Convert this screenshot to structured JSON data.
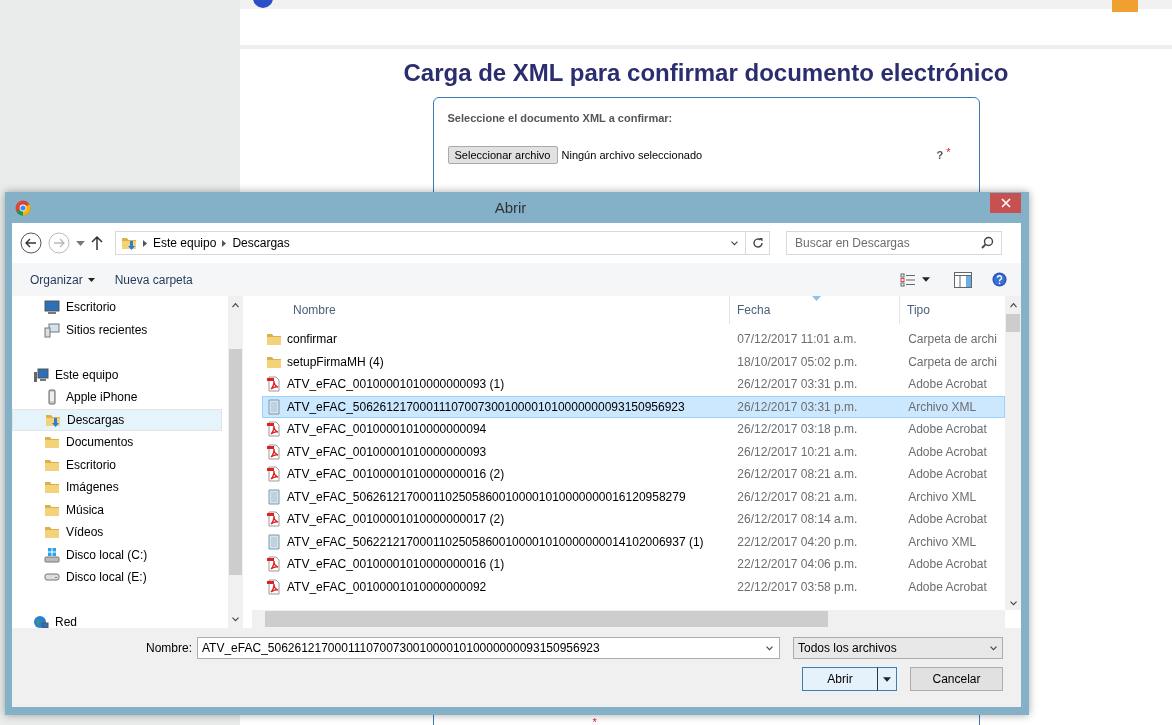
{
  "page": {
    "title": "Carga de XML para confirmar documento electrónico",
    "form": {
      "label": "Seleccione el documento XML a confirmar:",
      "file_button": "Seleccionar archivo",
      "file_status": "Ningún archivo seleccionado",
      "help": "?",
      "required": "*",
      "required_bottom": "*"
    }
  },
  "dialog": {
    "title": "Abrir",
    "breadcrumbs": [
      "Este equipo",
      "Descargas"
    ],
    "search": {
      "placeholder": "Buscar en Descargas"
    },
    "toolbar": {
      "organize": "Organizar",
      "new_folder": "Nueva carpeta"
    },
    "nav": [
      {
        "children": [
          {
            "label": "Escritorio",
            "kind": "desktop",
            "selected": false
          },
          {
            "label": "Sitios recientes",
            "kind": "recent",
            "selected": false
          }
        ]
      },
      {
        "label": "Este equipo",
        "kind": "computer",
        "selected": false,
        "children": [
          {
            "label": "Apple iPhone",
            "kind": "phone",
            "selected": false
          },
          {
            "label": "Descargas",
            "kind": "downloads",
            "selected": true
          },
          {
            "label": "Documentos",
            "kind": "folder",
            "selected": false
          },
          {
            "label": "Escritorio",
            "kind": "folder",
            "selected": false
          },
          {
            "label": "Imágenes",
            "kind": "folder",
            "selected": false
          },
          {
            "label": "Música",
            "kind": "folder",
            "selected": false
          },
          {
            "label": "Vídeos",
            "kind": "folder",
            "selected": false
          },
          {
            "label": "Disco local (C:)",
            "kind": "system-drive",
            "selected": false
          },
          {
            "label": "Disco local (E:)",
            "kind": "drive",
            "selected": false
          }
        ]
      },
      {
        "label": "Red",
        "kind": "network",
        "selected": false
      }
    ],
    "columns": [
      "Nombre",
      "Fecha",
      "Tipo"
    ],
    "files": [
      {
        "kind": "folder",
        "name": "confirmar",
        "date": "07/12/2017 11:01 a.m.",
        "type": "Carpeta de archi",
        "selected": false
      },
      {
        "kind": "folder",
        "name": "setupFirmaMH (4)",
        "date": "18/10/2017 05:02 p.m.",
        "type": "Carpeta de archi",
        "selected": false
      },
      {
        "kind": "pdf",
        "name": "ATV_eFAC_00100001010000000093 (1)",
        "date": "26/12/2017 03:31 p.m.",
        "type": "Adobe Acrobat",
        "selected": false
      },
      {
        "kind": "xml",
        "name": "ATV_eFAC_50626121700011107007300100001010000000093150956923",
        "date": "26/12/2017 03:31 p.m.",
        "type": "Archivo XML",
        "selected": true
      },
      {
        "kind": "pdf",
        "name": "ATV_eFAC_00100001010000000094",
        "date": "26/12/2017 03:18 p.m.",
        "type": "Adobe Acrobat",
        "selected": false
      },
      {
        "kind": "pdf",
        "name": "ATV_eFAC_00100001010000000093",
        "date": "26/12/2017 10:21 a.m.",
        "type": "Adobe Acrobat",
        "selected": false
      },
      {
        "kind": "pdf",
        "name": "ATV_eFAC_00100001010000000016 (2)",
        "date": "26/12/2017 08:21 a.m.",
        "type": "Adobe Acrobat",
        "selected": false
      },
      {
        "kind": "xml",
        "name": "ATV_eFAC_50626121700011025058600100001010000000016120958279",
        "date": "26/12/2017 08:21 a.m.",
        "type": "Archivo XML",
        "selected": false
      },
      {
        "kind": "pdf",
        "name": "ATV_eFAC_00100001010000000017 (2)",
        "date": "26/12/2017 08:14 a.m.",
        "type": "Adobe Acrobat",
        "selected": false
      },
      {
        "kind": "xml",
        "name": "ATV_eFAC_50622121700011025058600100001010000000014102006937 (1)",
        "date": "22/12/2017 04:20 p.m.",
        "type": "Archivo XML",
        "selected": false
      },
      {
        "kind": "pdf",
        "name": "ATV_eFAC_00100001010000000016 (1)",
        "date": "22/12/2017 04:06 p.m.",
        "type": "Adobe Acrobat",
        "selected": false
      },
      {
        "kind": "pdf",
        "name": "ATV_eFAC_00100001010000000092",
        "date": "22/12/2017 03:58 p.m.",
        "type": "Adobe Acrobat",
        "selected": false
      }
    ],
    "filename_label": "Nombre:",
    "filename": "ATV_eFAC_50626121700011107007300100001010000000093150956923",
    "filter": "Todos los archivos",
    "buttons": {
      "open": "Abrir",
      "cancel": "Cancelar"
    }
  }
}
